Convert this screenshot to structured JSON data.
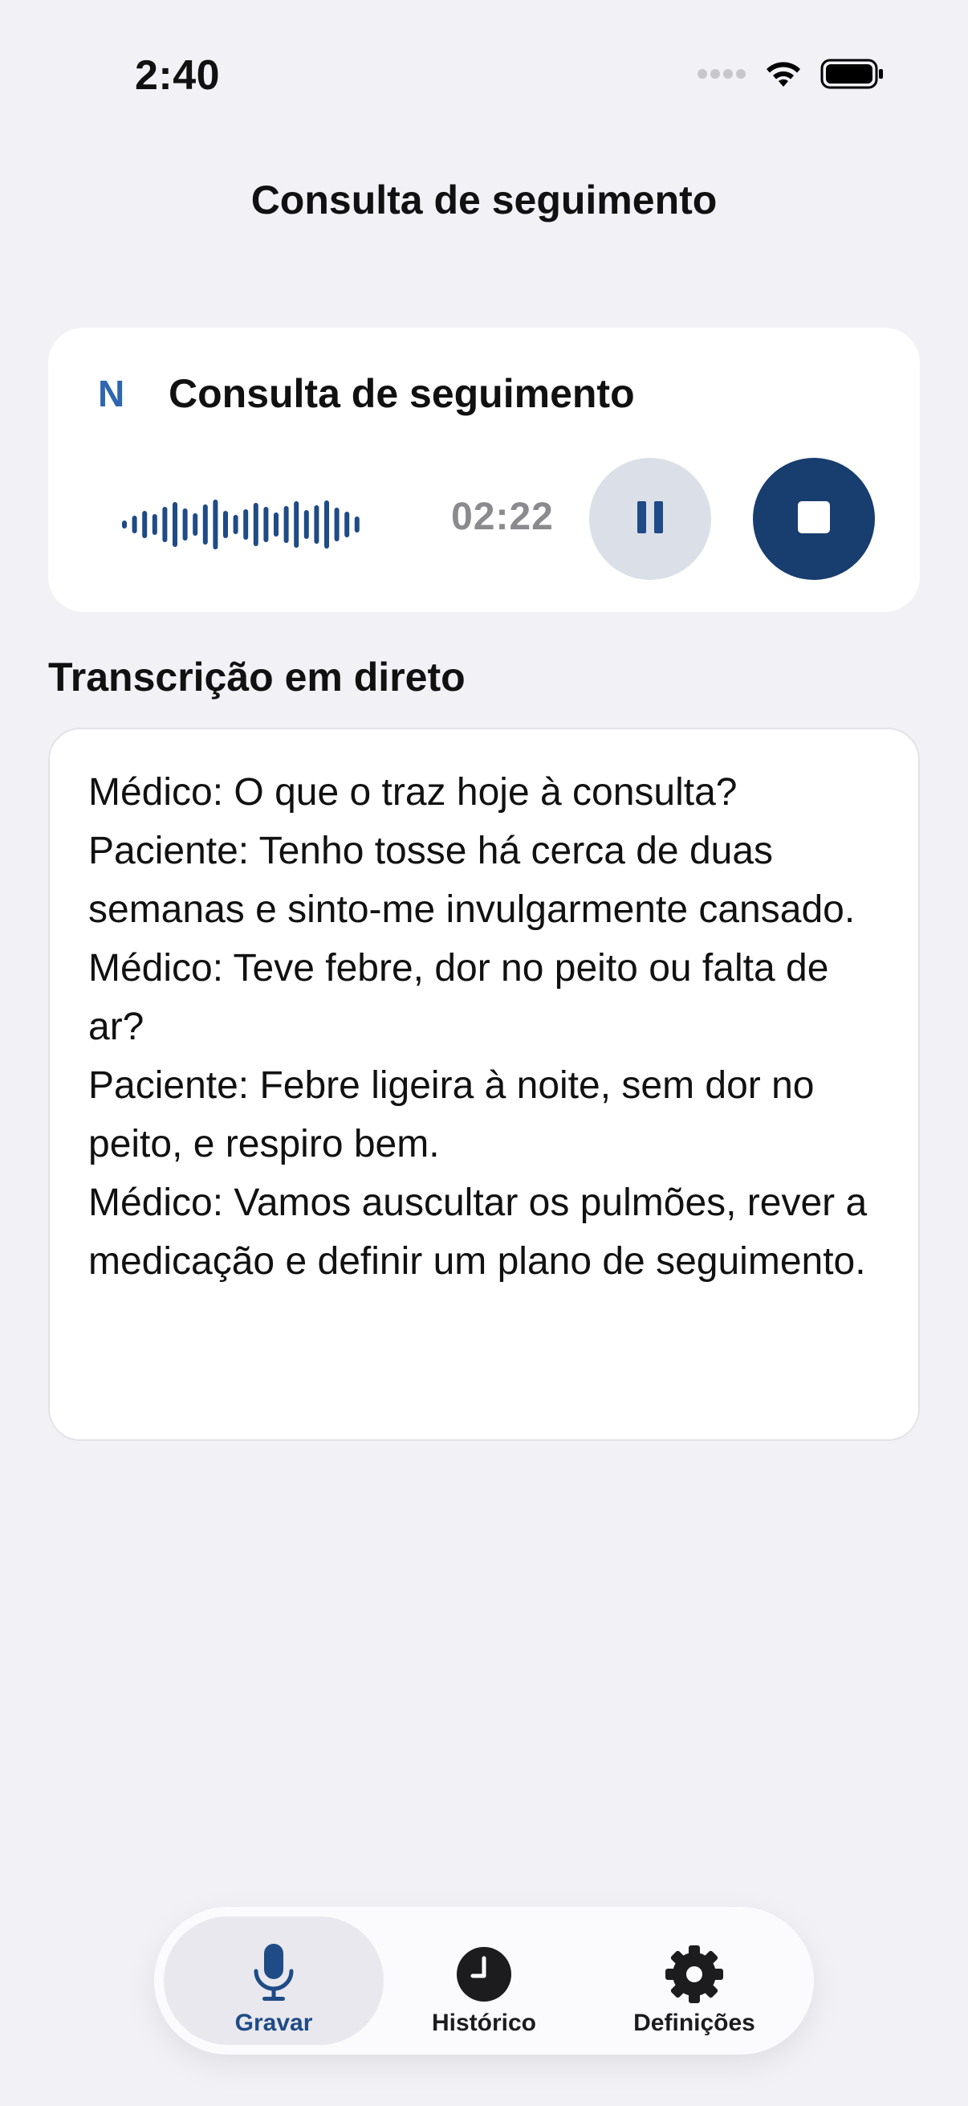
{
  "status_bar": {
    "time": "2:40",
    "icons": [
      "signal-dots-icon",
      "wifi-icon",
      "battery-icon"
    ]
  },
  "header": {
    "title": "Consulta de seguimento"
  },
  "recording_card": {
    "logo_letter": "N",
    "title": "Consulta de seguimento",
    "timer": "02:22",
    "buttons": {
      "pause": "pause-icon",
      "stop": "stop-icon"
    }
  },
  "transcript": {
    "heading": "Transcrição em direto",
    "lines": [
      "Médico: O que o traz hoje à consulta?",
      "Paciente: Tenho tosse há cerca de duas semanas e sinto-me invulgarmente cansado.",
      "Médico: Teve febre, dor no peito ou falta de ar?",
      "Paciente: Febre ligeira à noite, sem dor no peito, e respiro bem.",
      "Médico: Vamos auscultar os pulmões, rever a medicação e definir um plano de seguimento."
    ]
  },
  "tab_bar": {
    "tabs": [
      {
        "label": "Gravar",
        "icon": "microphone-icon",
        "active": true
      },
      {
        "label": "Histórico",
        "icon": "clock-icon",
        "active": false
      },
      {
        "label": "Definições",
        "icon": "gear-icon",
        "active": false
      }
    ]
  },
  "colors": {
    "accent": "#183d6f",
    "logo": "#2f66b0",
    "background": "#f1f1f6",
    "pause_button": "#dbe0e8"
  }
}
